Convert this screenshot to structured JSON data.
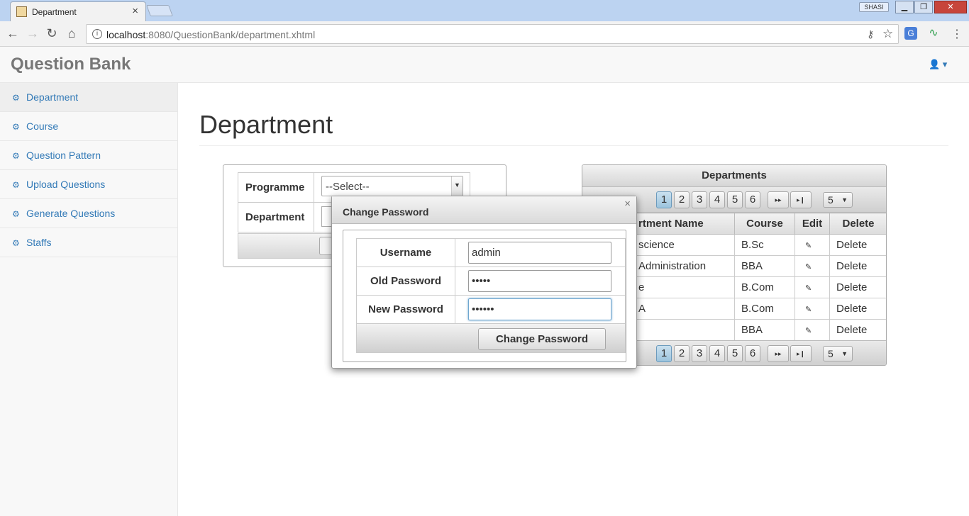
{
  "browser": {
    "tab_title": "Department",
    "tab_close": "×",
    "user_badge": "SHASI",
    "win_min": "▁",
    "win_max": "❐",
    "win_close": "✕",
    "back": "←",
    "forward": "→",
    "reload": "↻",
    "home": "⌂",
    "url_host": "localhost",
    "url_path": ":8080/QuestionBank/department.xhtml",
    "info_icon": "i",
    "key_icon": "⚷",
    "star_icon": "☆",
    "menu_icon": "⋮"
  },
  "app": {
    "brand": "Question Bank",
    "user_icon": "👤 ▾"
  },
  "sidebar": {
    "items": [
      {
        "label": "Department"
      },
      {
        "label": "Course"
      },
      {
        "label": "Question Pattern"
      },
      {
        "label": "Upload Questions"
      },
      {
        "label": "Generate Questions"
      },
      {
        "label": "Staffs"
      }
    ]
  },
  "page": {
    "title": "Department"
  },
  "form": {
    "programme_label": "Programme",
    "programme_value": "--Select--",
    "department_label": "Department"
  },
  "grid": {
    "header": "Departments",
    "pages": [
      "1",
      "2",
      "3",
      "4",
      "5",
      "6"
    ],
    "next": "▸▸",
    "last": "▸❙",
    "rows_per_page": "5",
    "columns": [
      "rtment Name",
      "Course",
      "Edit",
      "Delete"
    ],
    "rows": [
      {
        "name": "science",
        "course": "B.Sc",
        "edit": "✎",
        "delete": "Delete"
      },
      {
        "name": "Administration",
        "course": "BBA",
        "edit": "✎",
        "delete": "Delete"
      },
      {
        "name": "e",
        "course": "B.Com",
        "edit": "✎",
        "delete": "Delete"
      },
      {
        "name": "A",
        "course": "B.Com",
        "edit": "✎",
        "delete": "Delete"
      },
      {
        "name": "",
        "course": "BBA",
        "edit": "✎",
        "delete": "Delete"
      }
    ]
  },
  "dialog": {
    "title": "Change Password",
    "close": "×",
    "username_label": "Username",
    "username_value": "admin",
    "old_password_label": "Old Password",
    "old_password_value": "•••••",
    "new_password_label": "New Password",
    "new_password_value": "••••••",
    "submit_label": "Change Password"
  },
  "colors": {
    "link": "#337ab7",
    "brand_text": "#777777",
    "active_page": "#9cc4dd"
  }
}
